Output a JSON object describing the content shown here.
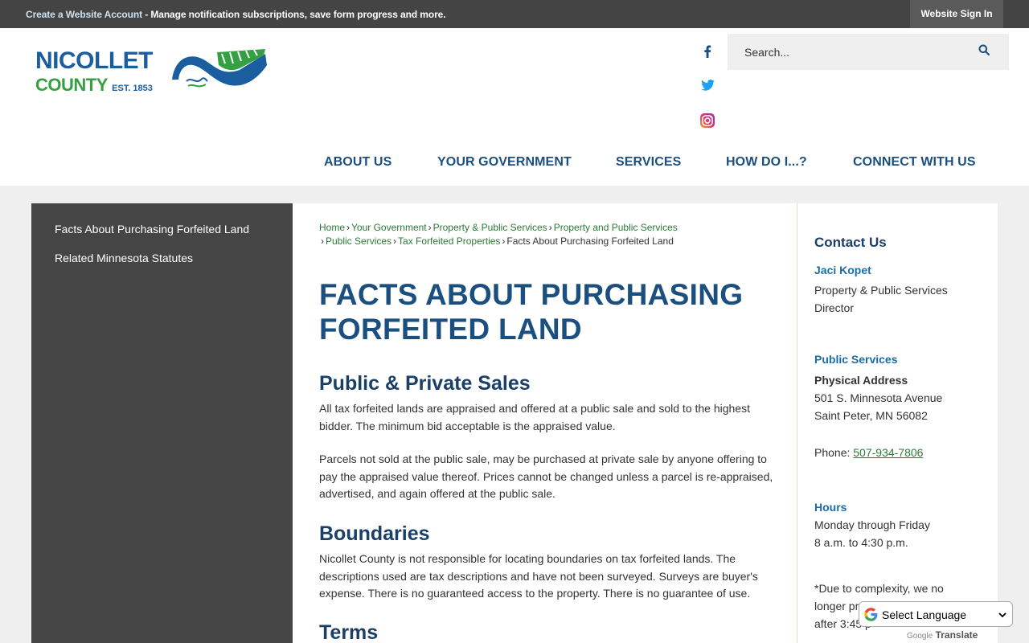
{
  "topbar": {
    "account_link": "Create a Website Account",
    "message": " - Manage notification subscriptions, save form progress and more.",
    "signin": "Website Sign In"
  },
  "logo": {
    "line1": "NICOLLET",
    "line2": "COUNTY",
    "est": "EST. 1853"
  },
  "search": {
    "placeholder": "Search..."
  },
  "nav": [
    "ABOUT US",
    "YOUR GOVERNMENT",
    "SERVICES",
    "HOW DO I...?",
    "CONNECT WITH US"
  ],
  "sidebar": {
    "items": [
      "Facts About Purchasing Forfeited Land",
      "Related Minnesota Statutes"
    ]
  },
  "breadcrumb": {
    "line1": [
      "Home",
      "Your Government",
      "Property & Public Services",
      "Property and Public Services"
    ],
    "line2": [
      "Public Services",
      "Tax Forfeited Properties"
    ],
    "current": "Facts About Purchasing Forfeited Land",
    "separator": "›"
  },
  "main": {
    "title_line1": "FACTS ABOUT PURCHASING",
    "title_line2": "FORFEITED LAND",
    "sections": [
      {
        "heading": "Public & Private Sales",
        "paragraphs": [
          "All tax forfeited lands are appraised and offered at a public sale and sold to the highest bidder. The minimum bid acceptable is the appraised value.",
          "Parcels not sold at the public sale, may be purchased at private sale by anyone offering to pay the appraised value thereof. Prices cannot be changed unless a parcel is re-appraised, advertised, and again offered at the public sale."
        ]
      },
      {
        "heading": "Boundaries",
        "paragraphs": [
          "Nicollet County is not responsible for locating boundaries on tax forfeited lands. The descriptions used are tax descriptions and have not been surveyed. Surveys are buyer's expense. There is no guaranteed access to the property. There is no guarantee of use."
        ]
      },
      {
        "heading": "Terms",
        "paragraphs": []
      }
    ]
  },
  "contact": {
    "title": "Contact Us",
    "name": "Jaci Kopet",
    "role_line1": "Property & Public Services",
    "role_line2": "Director",
    "dept": "Public Services",
    "address_label": "Physical Address",
    "address_line1": "501 S. Minnesota Avenue",
    "address_line2": "Saint Peter, MN 56082",
    "phone_label": "Phone: ",
    "phone": "507-934-7806",
    "hours_label": "Hours",
    "hours_line1": "Monday through Friday",
    "hours_line2": "8 a.m. to 4:30 p.m.",
    "note_line1": "*Due to complexity, we no",
    "note_line2": "longer pro",
    "note_line3": "after 3:45 p"
  },
  "translate": {
    "label": "Select Language",
    "powered_by": "Google",
    "translate": "Translate"
  },
  "colors": {
    "topbar": "#444444",
    "nav": "#1b4f80",
    "link_green": "#2a7a35",
    "sidebar": "#454545",
    "logo_blue": "#1a5ea0",
    "logo_green": "#35a043"
  }
}
